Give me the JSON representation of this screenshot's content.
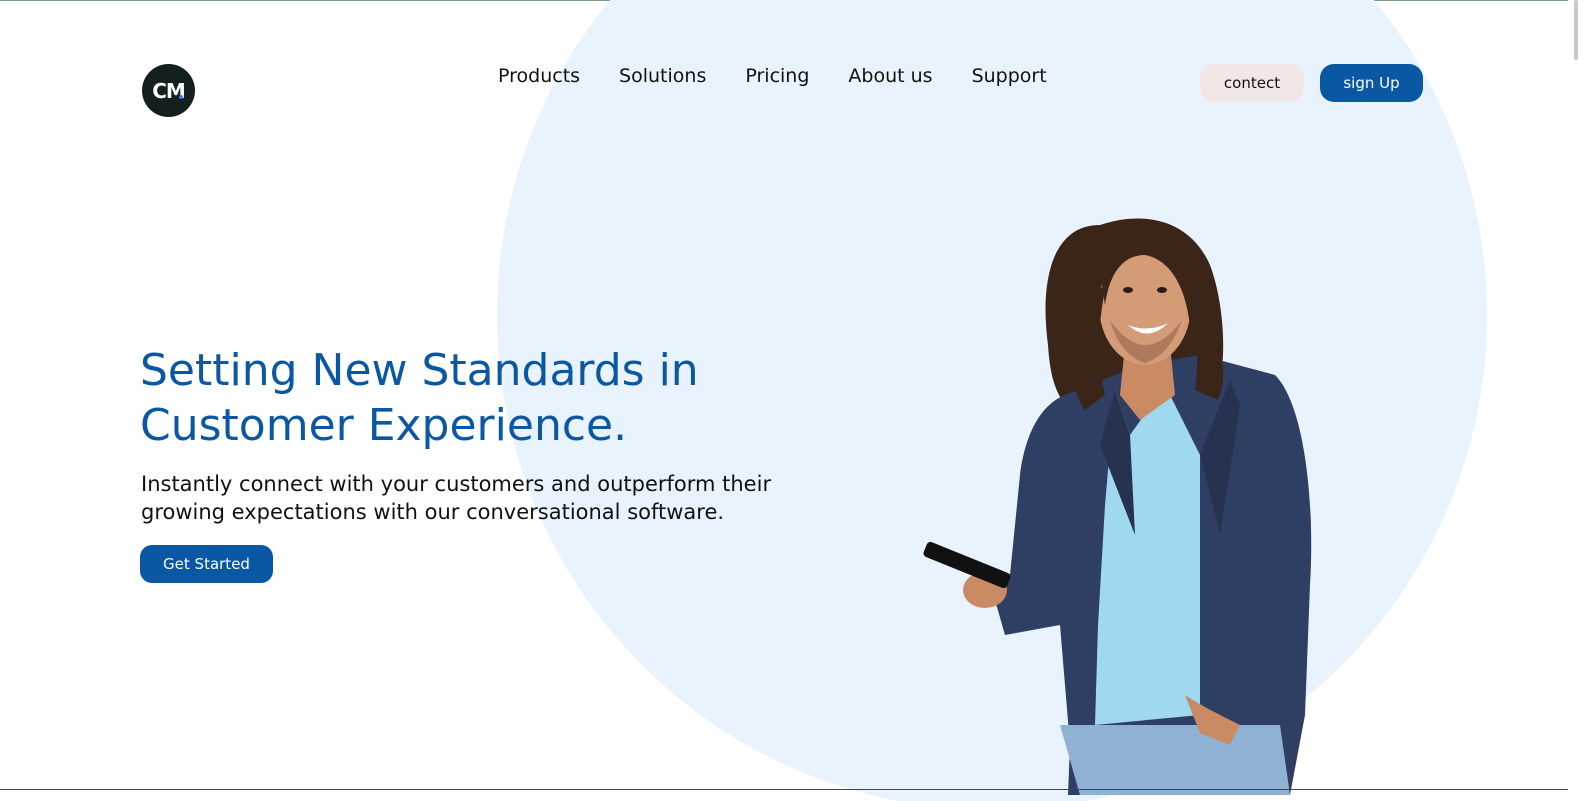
{
  "brand": {
    "logo_text": "CM",
    "logo_name": "cm-logo"
  },
  "nav": {
    "items": [
      {
        "label": "Products"
      },
      {
        "label": "Solutions"
      },
      {
        "label": "Pricing"
      },
      {
        "label": "About us"
      },
      {
        "label": "Support"
      }
    ]
  },
  "header_actions": {
    "contact_label": "contect",
    "signup_label": "sign Up"
  },
  "hero": {
    "headline_line1": "Setting New Standards in",
    "headline_line2": "Customer Experience.",
    "subtext_line1": "Instantly connect with your customers and outperform their",
    "subtext_line2": "growing expectations with our conversational software.",
    "cta_label": "Get Started",
    "image_alt": "smiling man with long hair holding a phone"
  },
  "colors": {
    "primary": "#0a57a4",
    "circle_bg": "#e9f3fd",
    "contact_bg": "#f3e6e6",
    "logo_bg": "#13201f"
  }
}
